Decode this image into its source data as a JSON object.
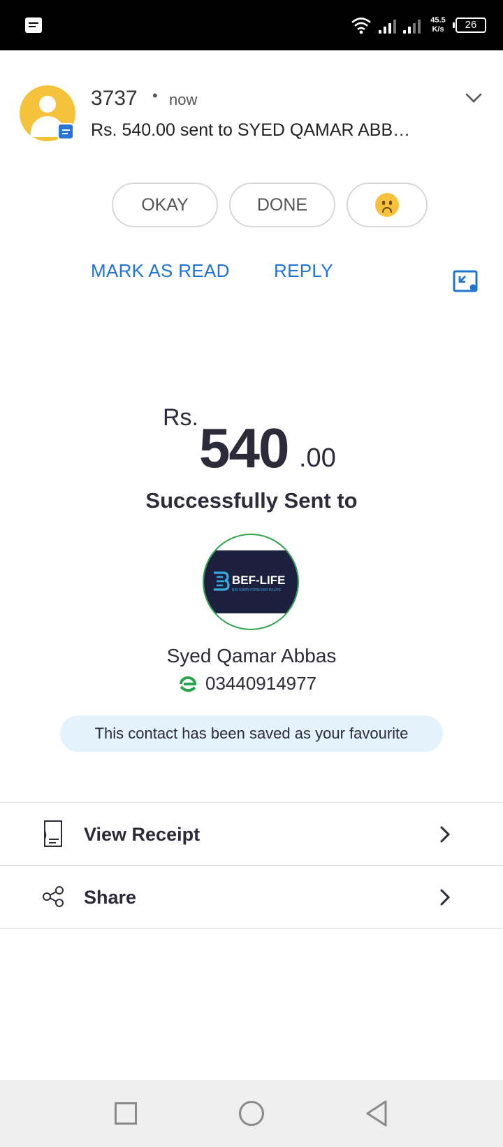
{
  "status_bar": {
    "net_speed_value": "45.5",
    "net_speed_unit": "K/s",
    "battery": "26"
  },
  "notification": {
    "sender": "3737",
    "separator": "•",
    "time": "now",
    "preview": "Rs. 540.00 sent to SYED QAMAR ABB…",
    "quick_replies": [
      "OKAY",
      "DONE"
    ],
    "emoji_reply": "worried-face-emoji",
    "actions": {
      "mark_as_read": "MARK AS READ",
      "reply": "REPLY"
    }
  },
  "payment": {
    "currency": "Rs.",
    "amount_main": "540",
    "amount_cents": ".00",
    "status": "Successfully Sent to",
    "recipient": {
      "logo_text": "BEF-LIFE",
      "logo_tagline": "BIG EARN FOREVER IN LIFE",
      "name": "Syed Qamar Abbas",
      "number": "03440914977"
    },
    "favourite_notice": "This contact has been saved as your favourite"
  },
  "options": [
    {
      "label": "View Receipt",
      "icon": "receipt-icon"
    },
    {
      "label": "Share",
      "icon": "share-icon"
    }
  ],
  "colors": {
    "accent_blue": "#1f74d4",
    "avatar_yellow": "#f5c33b",
    "success_green": "#2ea34e",
    "fav_pill_bg": "#e4f2fb"
  }
}
